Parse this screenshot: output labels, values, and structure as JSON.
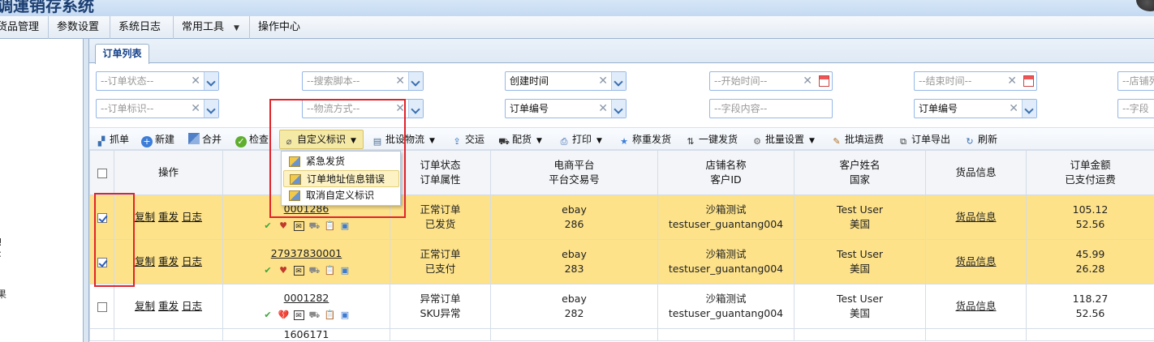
{
  "app": {
    "title_fragment": "调運销存系统"
  },
  "menu": [
    {
      "label": "货品管理"
    },
    {
      "label": "参数设置"
    },
    {
      "label": "系统日志"
    },
    {
      "label": "常用工具",
      "has_dropdown": true
    },
    {
      "label": "操作中心"
    }
  ],
  "left_panel": {
    "fragments": [
      "!",
      ":",
      "果"
    ]
  },
  "tabs": [
    {
      "label": "订单列表",
      "active": true
    }
  ],
  "filters": {
    "order_status": {
      "placeholder": "--订单状态--"
    },
    "search_script": {
      "placeholder": "--搜索脚本--"
    },
    "time_type": {
      "value": "创建时间"
    },
    "start_time": {
      "placeholder": "--开始时间--"
    },
    "end_time": {
      "placeholder": "--结束时间--"
    },
    "shop": {
      "placeholder": "--店铺列"
    },
    "order_flag": {
      "placeholder": "--订单标识--"
    },
    "logistics": {
      "placeholder": "--物流方式--"
    },
    "field_select": {
      "value": "订单编号"
    },
    "field_content": {
      "placeholder": "--字段内容--"
    },
    "field_select2": {
      "value": "订单编号"
    },
    "field_placeholder3": {
      "placeholder": "--字段"
    }
  },
  "toolbar": [
    {
      "label": "抓单",
      "icon": "sitemap-icon"
    },
    {
      "label": "新建",
      "icon": "plus-circle-icon"
    },
    {
      "label": "合并",
      "icon": "merge-icon"
    },
    {
      "label": "检查",
      "icon": "check-circle-icon"
    },
    {
      "label": "自定义标识",
      "icon": "paperclip-icon",
      "has_dropdown": true,
      "active": true
    },
    {
      "label": "批设物流",
      "icon": "logistics-icon",
      "has_dropdown": true
    },
    {
      "label": "交运",
      "icon": "ship-icon"
    },
    {
      "label": "配货",
      "icon": "cart-icon",
      "has_dropdown": true
    },
    {
      "label": "打印",
      "icon": "printer-icon",
      "has_dropdown": true
    },
    {
      "label": "称重发货",
      "icon": "star-icon"
    },
    {
      "label": "一键发货",
      "icon": "arrows-icon"
    },
    {
      "label": "批量设置",
      "icon": "gears-icon",
      "has_dropdown": true
    },
    {
      "label": "批填运费",
      "icon": "edit-icon"
    },
    {
      "label": "订单导出",
      "icon": "export-icon"
    },
    {
      "label": "刷新",
      "icon": "refresh-icon"
    }
  ],
  "custom_flag_menu": [
    {
      "label": "紧急发货"
    },
    {
      "label": "订单地址信息错误",
      "highlighted": true
    },
    {
      "label": "取消自定义标识"
    }
  ],
  "table": {
    "headers": {
      "operation": "操作",
      "status_1": "订单状态",
      "status_2": "订单属性",
      "platform_1": "电商平台",
      "platform_2": "平台交易号",
      "shop_1": "店铺名称",
      "shop_2": "客户ID",
      "customer_1": "客户姓名",
      "customer_2": "国家",
      "goods": "货品信息",
      "amount_1": "订单金额",
      "amount_2": "已支付运费"
    },
    "row_actions": {
      "copy": "复制",
      "resend": "重发",
      "log": "日志"
    },
    "rows": [
      {
        "selected": true,
        "order_no": "0001286",
        "status": "正常订单",
        "attr": "已发货",
        "platform": "ebay",
        "trade_no": "286",
        "shop": "沙箱测试",
        "customer_id": "testuser_guantang004",
        "customer": "Test User",
        "country": "美国",
        "goods": "货品信息",
        "amount": "105.12",
        "freight": "52.56",
        "heart": "red"
      },
      {
        "selected": true,
        "order_no": "27937830001",
        "status": "正常订单",
        "attr": "已支付",
        "platform": "ebay",
        "trade_no": "283",
        "shop": "沙箱测试",
        "customer_id": "testuser_guantang004",
        "customer": "Test User",
        "country": "美国",
        "goods": "货品信息",
        "amount": "45.99",
        "freight": "26.28",
        "heart": "red"
      },
      {
        "selected": false,
        "order_no": "0001282",
        "status": "异常订单",
        "attr": "SKU异常",
        "platform": "ebay",
        "trade_no": "282",
        "shop": "沙箱测试",
        "customer_id": "testuser_guantang004",
        "customer": "Test User",
        "country": "美国",
        "goods": "货品信息",
        "amount": "118.27",
        "freight": "52.56",
        "heart": "broken"
      }
    ],
    "partial_row": {
      "order_no": "1606171"
    }
  },
  "colors": {
    "selected_row": "#fde28a",
    "highlight_box": "#e0232a",
    "accent": "#15428b"
  }
}
